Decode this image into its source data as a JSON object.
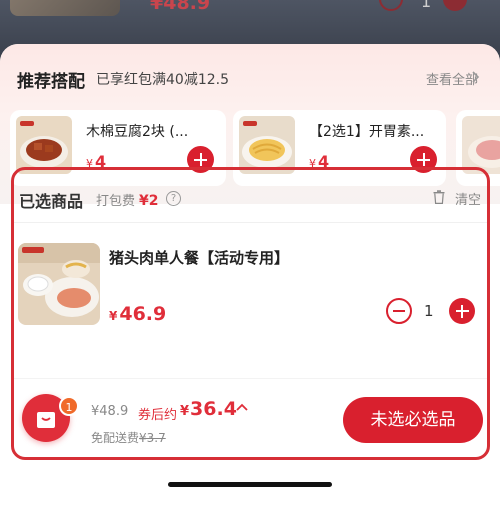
{
  "background": {
    "price": "¥48.9",
    "qty": "1"
  },
  "recommend": {
    "title": "推荐搭配",
    "subtitle": "已享红包满40减12.5",
    "more": "查看全部",
    "items": [
      {
        "name": "木棉豆腐2块 (...",
        "price": "4",
        "currency": "¥"
      },
      {
        "name": "【2选1】开胃素...",
        "price": "4",
        "currency": "¥"
      }
    ]
  },
  "selected": {
    "title": "已选商品",
    "pack_fee_label": "打包费",
    "pack_fee": "¥2",
    "help": "?",
    "clear": "清空",
    "items": [
      {
        "name": "猪头肉单人餐【活动专用】",
        "currency": "¥",
        "price": "46.9",
        "qty": "1"
      }
    ]
  },
  "footer": {
    "cart_count": "1",
    "original_total": "¥48.9",
    "after_coupon_label": "券后约",
    "after_coupon_currency": "¥",
    "after_coupon_total": "36.4",
    "after_coupon_chevron": "^",
    "delivery_label": "免配送费",
    "delivery_original": "¥3.7",
    "checkout": "未选必选品"
  },
  "colors": {
    "accent": "#d9202e",
    "price": "#e02e3a",
    "badge": "#f06a2a"
  }
}
